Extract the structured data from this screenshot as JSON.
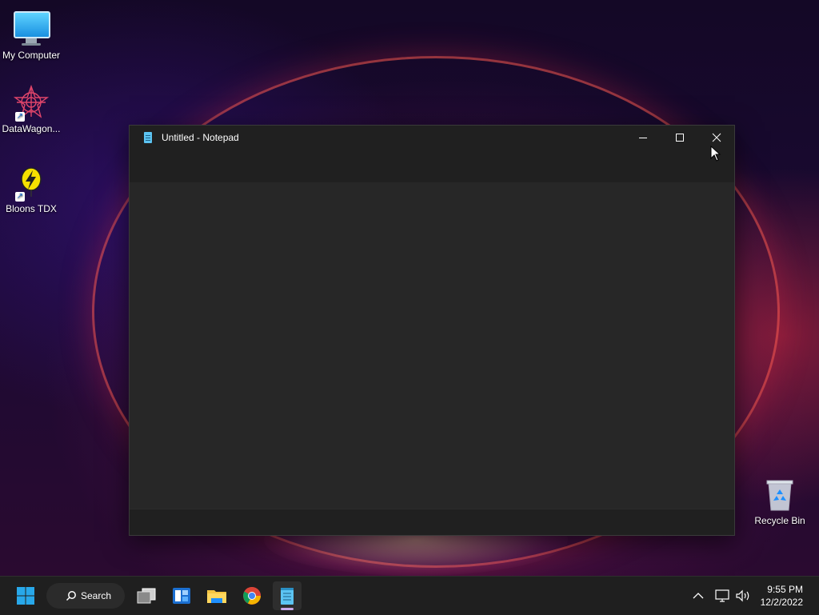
{
  "desktop": {
    "icons": [
      {
        "label": "My Computer",
        "icon": "computer-icon"
      },
      {
        "label": "DataWagon...",
        "icon": "datawagon-icon"
      },
      {
        "label": "Bloons TDX",
        "icon": "bloons-icon"
      },
      {
        "label": "Recycle Bin",
        "icon": "recycle-bin-icon"
      }
    ]
  },
  "window": {
    "title": "Untitled - Notepad",
    "icon": "notepad-icon",
    "content": ""
  },
  "taskbar": {
    "search_label": "Search",
    "apps": [
      "task-view-icon",
      "widgets-icon",
      "file-explorer-icon",
      "chrome-icon",
      "notepad-icon"
    ],
    "active_app": "notepad-icon",
    "clock": {
      "time": "9:55 PM",
      "date": "12/2/2022"
    }
  },
  "colors": {
    "accent_blue": "#1e90ff",
    "window_bg": "#272727",
    "titlebar_bg": "#202020",
    "taskbar_bg": "#1f1f1f"
  }
}
